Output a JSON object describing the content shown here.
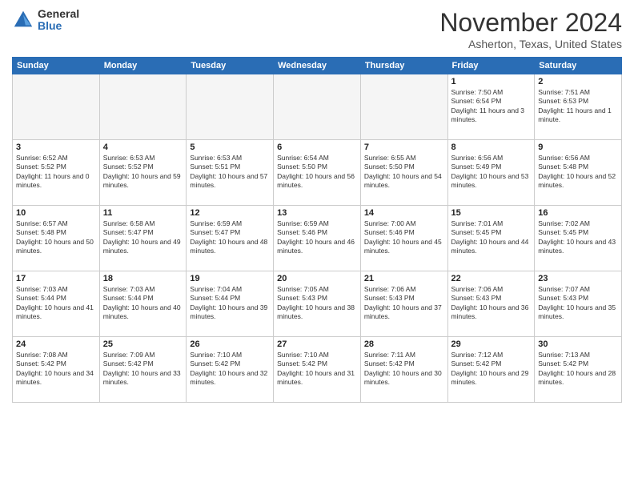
{
  "header": {
    "logo_general": "General",
    "logo_blue": "Blue",
    "month_title": "November 2024",
    "location": "Asherton, Texas, United States"
  },
  "days_of_week": [
    "Sunday",
    "Monday",
    "Tuesday",
    "Wednesday",
    "Thursday",
    "Friday",
    "Saturday"
  ],
  "weeks": [
    [
      {
        "day": "",
        "info": ""
      },
      {
        "day": "",
        "info": ""
      },
      {
        "day": "",
        "info": ""
      },
      {
        "day": "",
        "info": ""
      },
      {
        "day": "",
        "info": ""
      },
      {
        "day": "1",
        "info": "Sunrise: 7:50 AM\nSunset: 6:54 PM\nDaylight: 11 hours and 3 minutes."
      },
      {
        "day": "2",
        "info": "Sunrise: 7:51 AM\nSunset: 6:53 PM\nDaylight: 11 hours and 1 minute."
      }
    ],
    [
      {
        "day": "3",
        "info": "Sunrise: 6:52 AM\nSunset: 5:52 PM\nDaylight: 11 hours and 0 minutes."
      },
      {
        "day": "4",
        "info": "Sunrise: 6:53 AM\nSunset: 5:52 PM\nDaylight: 10 hours and 59 minutes."
      },
      {
        "day": "5",
        "info": "Sunrise: 6:53 AM\nSunset: 5:51 PM\nDaylight: 10 hours and 57 minutes."
      },
      {
        "day": "6",
        "info": "Sunrise: 6:54 AM\nSunset: 5:50 PM\nDaylight: 10 hours and 56 minutes."
      },
      {
        "day": "7",
        "info": "Sunrise: 6:55 AM\nSunset: 5:50 PM\nDaylight: 10 hours and 54 minutes."
      },
      {
        "day": "8",
        "info": "Sunrise: 6:56 AM\nSunset: 5:49 PM\nDaylight: 10 hours and 53 minutes."
      },
      {
        "day": "9",
        "info": "Sunrise: 6:56 AM\nSunset: 5:48 PM\nDaylight: 10 hours and 52 minutes."
      }
    ],
    [
      {
        "day": "10",
        "info": "Sunrise: 6:57 AM\nSunset: 5:48 PM\nDaylight: 10 hours and 50 minutes."
      },
      {
        "day": "11",
        "info": "Sunrise: 6:58 AM\nSunset: 5:47 PM\nDaylight: 10 hours and 49 minutes."
      },
      {
        "day": "12",
        "info": "Sunrise: 6:59 AM\nSunset: 5:47 PM\nDaylight: 10 hours and 48 minutes."
      },
      {
        "day": "13",
        "info": "Sunrise: 6:59 AM\nSunset: 5:46 PM\nDaylight: 10 hours and 46 minutes."
      },
      {
        "day": "14",
        "info": "Sunrise: 7:00 AM\nSunset: 5:46 PM\nDaylight: 10 hours and 45 minutes."
      },
      {
        "day": "15",
        "info": "Sunrise: 7:01 AM\nSunset: 5:45 PM\nDaylight: 10 hours and 44 minutes."
      },
      {
        "day": "16",
        "info": "Sunrise: 7:02 AM\nSunset: 5:45 PM\nDaylight: 10 hours and 43 minutes."
      }
    ],
    [
      {
        "day": "17",
        "info": "Sunrise: 7:03 AM\nSunset: 5:44 PM\nDaylight: 10 hours and 41 minutes."
      },
      {
        "day": "18",
        "info": "Sunrise: 7:03 AM\nSunset: 5:44 PM\nDaylight: 10 hours and 40 minutes."
      },
      {
        "day": "19",
        "info": "Sunrise: 7:04 AM\nSunset: 5:44 PM\nDaylight: 10 hours and 39 minutes."
      },
      {
        "day": "20",
        "info": "Sunrise: 7:05 AM\nSunset: 5:43 PM\nDaylight: 10 hours and 38 minutes."
      },
      {
        "day": "21",
        "info": "Sunrise: 7:06 AM\nSunset: 5:43 PM\nDaylight: 10 hours and 37 minutes."
      },
      {
        "day": "22",
        "info": "Sunrise: 7:06 AM\nSunset: 5:43 PM\nDaylight: 10 hours and 36 minutes."
      },
      {
        "day": "23",
        "info": "Sunrise: 7:07 AM\nSunset: 5:43 PM\nDaylight: 10 hours and 35 minutes."
      }
    ],
    [
      {
        "day": "24",
        "info": "Sunrise: 7:08 AM\nSunset: 5:42 PM\nDaylight: 10 hours and 34 minutes."
      },
      {
        "day": "25",
        "info": "Sunrise: 7:09 AM\nSunset: 5:42 PM\nDaylight: 10 hours and 33 minutes."
      },
      {
        "day": "26",
        "info": "Sunrise: 7:10 AM\nSunset: 5:42 PM\nDaylight: 10 hours and 32 minutes."
      },
      {
        "day": "27",
        "info": "Sunrise: 7:10 AM\nSunset: 5:42 PM\nDaylight: 10 hours and 31 minutes."
      },
      {
        "day": "28",
        "info": "Sunrise: 7:11 AM\nSunset: 5:42 PM\nDaylight: 10 hours and 30 minutes."
      },
      {
        "day": "29",
        "info": "Sunrise: 7:12 AM\nSunset: 5:42 PM\nDaylight: 10 hours and 29 minutes."
      },
      {
        "day": "30",
        "info": "Sunrise: 7:13 AM\nSunset: 5:42 PM\nDaylight: 10 hours and 28 minutes."
      }
    ]
  ]
}
